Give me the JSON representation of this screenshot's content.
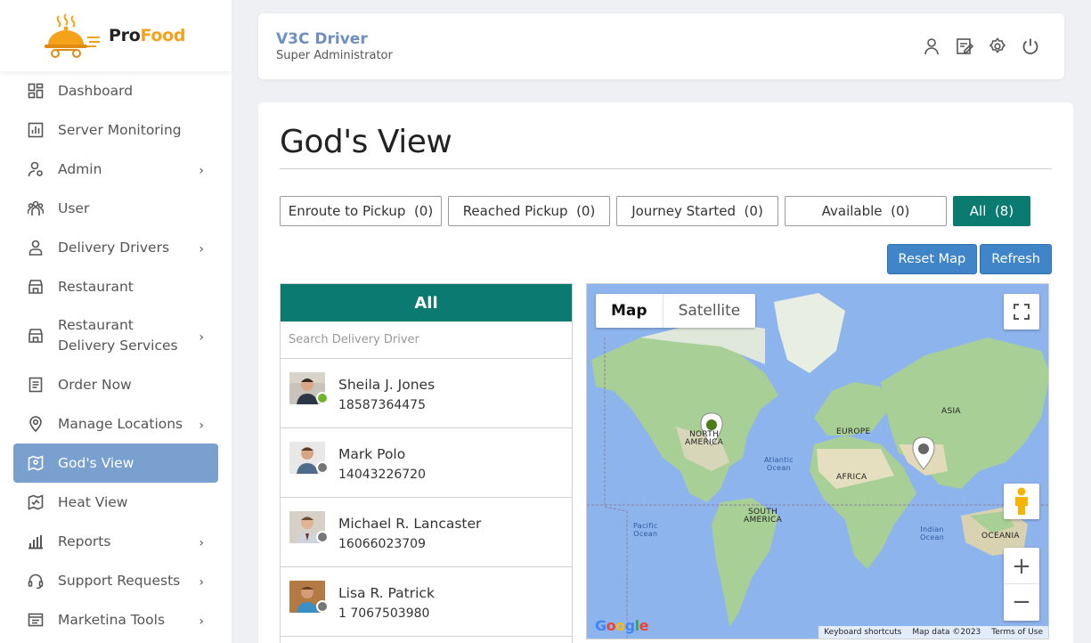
{
  "brand": {
    "pro": "Pro",
    "food": "Food",
    "primary_color": "#f5a21b"
  },
  "sidebar": {
    "items": [
      {
        "label": "Dashboard",
        "icon": "dashboard-icon",
        "chevron": false
      },
      {
        "label": "Server Monitoring",
        "icon": "chart-icon",
        "chevron": false
      },
      {
        "label": "Admin",
        "icon": "admin-icon",
        "chevron": true
      },
      {
        "label": "User",
        "icon": "users-icon",
        "chevron": false
      },
      {
        "label": "Delivery Drivers",
        "icon": "driver-icon",
        "chevron": true
      },
      {
        "label": "Restaurant",
        "icon": "store-icon",
        "chevron": false
      },
      {
        "label": "Restaurant Delivery Services",
        "icon": "store-icon",
        "chevron": true
      },
      {
        "label": "Order Now",
        "icon": "order-icon",
        "chevron": false
      },
      {
        "label": "Manage Locations",
        "icon": "location-icon",
        "chevron": true
      },
      {
        "label": "God's View",
        "icon": "map-icon",
        "chevron": false,
        "active": true
      },
      {
        "label": "Heat View",
        "icon": "heat-map-icon",
        "chevron": false
      },
      {
        "label": "Reports",
        "icon": "bar-chart-icon",
        "chevron": true
      },
      {
        "label": "Support Requests",
        "icon": "headset-icon",
        "chevron": true
      },
      {
        "label": "Marketina Tools",
        "icon": "tools-icon",
        "chevron": true
      }
    ],
    "active_color": "#7aa0cf"
  },
  "header": {
    "title": "V3C Driver",
    "subtitle": "Super Administrator",
    "icons": [
      "user-icon",
      "edit-icon",
      "settings-icon",
      "power-icon"
    ]
  },
  "main": {
    "title": "God's View",
    "filters": [
      {
        "label": "Enroute to Pickup",
        "count": "(0)"
      },
      {
        "label": "Reached Pickup",
        "count": "(0)"
      },
      {
        "label": "Journey Started",
        "count": "(0)"
      },
      {
        "label": "Available",
        "count": "(0)"
      },
      {
        "label": "All",
        "count": "(8)",
        "active": true
      }
    ],
    "buttons": {
      "reset": "Reset Map",
      "refresh": "Refresh"
    },
    "accent": "#0b7a71"
  },
  "drivers": {
    "panel_title": "All",
    "search_placeholder": "Search Delivery Driver",
    "list": [
      {
        "name": "Sheila J. Jones",
        "phone": "18587364475",
        "status": "online",
        "status_color": "#6fb52c"
      },
      {
        "name": "Mark Polo",
        "phone": "14043226720",
        "status": "offline",
        "status_color": "#777777"
      },
      {
        "name": "Michael R. Lancaster",
        "phone": "16066023709",
        "status": "offline",
        "status_color": "#777777"
      },
      {
        "name": "Lisa R. Patrick",
        "phone": "1 7067503980",
        "status": "offline",
        "status_color": "#777777"
      }
    ]
  },
  "map": {
    "types": [
      "Map",
      "Satellite"
    ],
    "active_type": "Map",
    "labels": {
      "north_america_1": "NORTH",
      "north_america_2": "AMERICA",
      "south_america_1": "SOUTH",
      "south_america_2": "AMERICA",
      "europe": "EUROPE",
      "asia": "ASIA",
      "africa": "AFRICA",
      "oceania": "OCEANIA",
      "atlantic_1": "Atlantic",
      "atlantic_2": "Ocean",
      "pacific_1": "Pacific",
      "pacific_2": "Ocean",
      "indian_1": "Indian",
      "indian_2": "Ocean"
    },
    "google": "Google",
    "footer": {
      "shortcuts": "Keyboard shortcuts",
      "data": "Map data ©2023",
      "terms": "Terms of Use"
    },
    "zoom_in": "+",
    "zoom_out": "−"
  }
}
